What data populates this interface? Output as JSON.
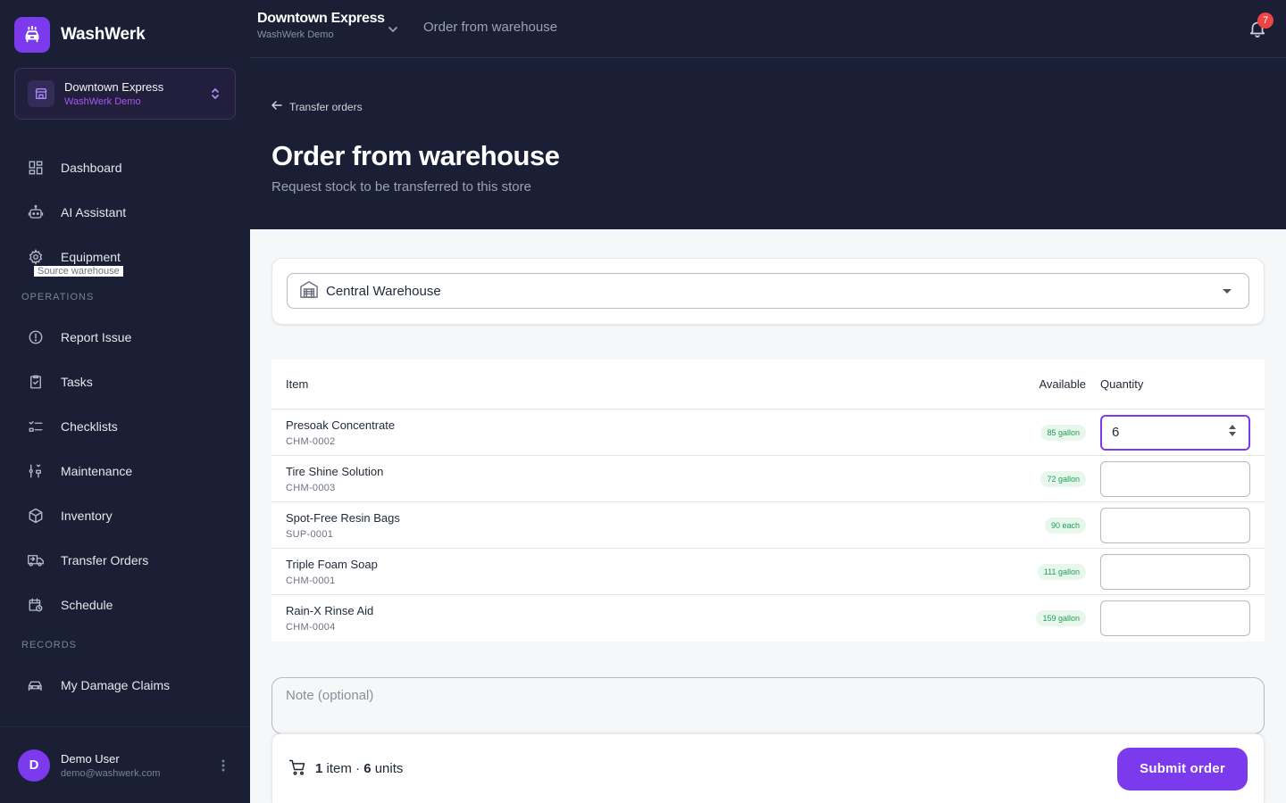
{
  "app": {
    "name": "WashWerk"
  },
  "store_switcher": {
    "name": "Downtown Express",
    "org": "WashWerk Demo"
  },
  "nav": {
    "items_top": [
      {
        "label": "Dashboard",
        "icon": "dashboard-icon"
      },
      {
        "label": "AI Assistant",
        "icon": "robot-icon"
      },
      {
        "label": "Equipment",
        "icon": "gear-icon"
      }
    ],
    "section_operations": "OPERATIONS",
    "items_operations": [
      {
        "label": "Report Issue",
        "icon": "alert-circle-icon"
      },
      {
        "label": "Tasks",
        "icon": "clipboard-check-icon"
      },
      {
        "label": "Checklists",
        "icon": "checklist-icon"
      },
      {
        "label": "Maintenance",
        "icon": "wrench-icon"
      },
      {
        "label": "Inventory",
        "icon": "box-icon"
      },
      {
        "label": "Transfer Orders",
        "icon": "truck-icon"
      },
      {
        "label": "Schedule",
        "icon": "calendar-clock-icon"
      }
    ],
    "section_records": "RECORDS",
    "items_records": [
      {
        "label": "My Damage Claims",
        "icon": "car-damage-icon"
      }
    ]
  },
  "user": {
    "initial": "D",
    "name": "Demo User",
    "email": "demo@washwerk.com"
  },
  "header": {
    "store_name": "Downtown Express",
    "store_org": "WashWerk Demo",
    "page_title": "Order from warehouse",
    "notification_count": "7"
  },
  "page": {
    "back_label": "Transfer orders",
    "title": "Order from warehouse",
    "subtitle": "Request stock to be transferred to this store"
  },
  "warehouse": {
    "label": "Source warehouse",
    "value": "Central Warehouse"
  },
  "table": {
    "headers": {
      "item": "Item",
      "available": "Available",
      "quantity": "Quantity"
    },
    "rows": [
      {
        "name": "Presoak Concentrate",
        "sku": "CHM-0002",
        "available": "85 gallon",
        "quantity": "6"
      },
      {
        "name": "Tire Shine Solution",
        "sku": "CHM-0003",
        "available": "72 gallon",
        "quantity": ""
      },
      {
        "name": "Spot-Free Resin Bags",
        "sku": "SUP-0001",
        "available": "90 each",
        "quantity": ""
      },
      {
        "name": "Triple Foam Soap",
        "sku": "CHM-0001",
        "available": "111 gallon",
        "quantity": ""
      },
      {
        "name": "Rain-X Rinse Aid",
        "sku": "CHM-0004",
        "available": "159 gallon",
        "quantity": ""
      }
    ]
  },
  "note": {
    "placeholder": "Note (optional)"
  },
  "summary": {
    "item_count": "1",
    "item_word": "item",
    "separator": "·",
    "unit_count": "6",
    "unit_word": "units"
  },
  "submit_label": "Submit order",
  "colors": {
    "accent": "#7c3aed",
    "sidebar_bg": "#1a1f35",
    "badge": "#ef4444",
    "available_pill": "#22a05b"
  }
}
